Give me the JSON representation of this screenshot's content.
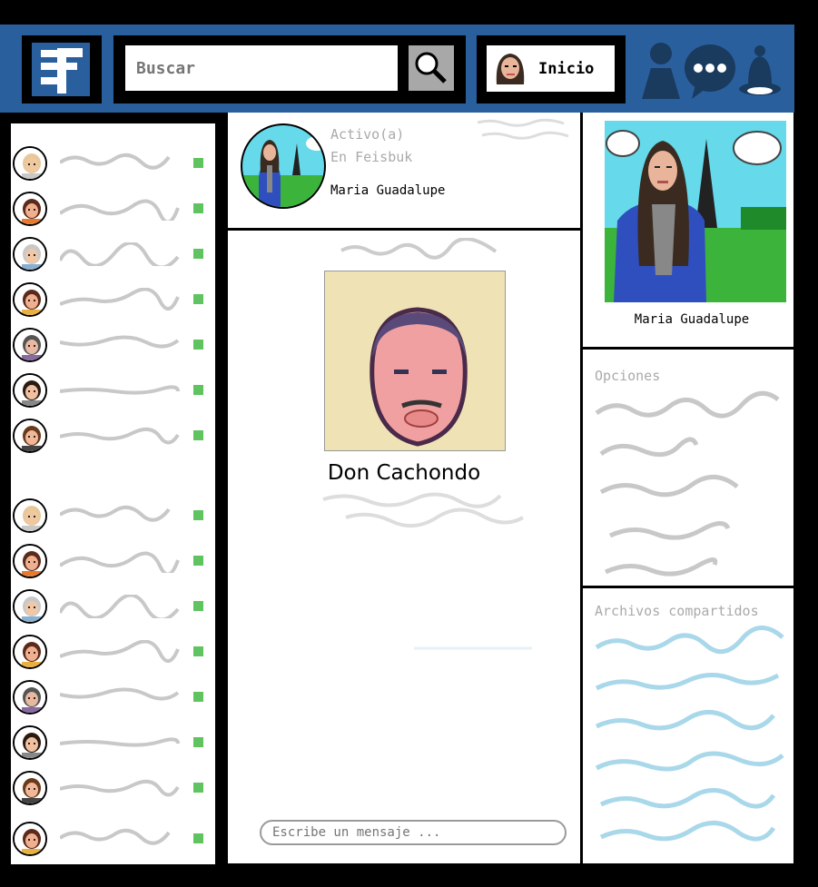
{
  "header": {
    "logo_icon": "feisbuk-logo-icon",
    "search": {
      "placeholder": "Buscar",
      "button_icon": "magnifier-icon"
    },
    "home": {
      "label": "Inicio",
      "avatar_icon": "user-avatar-icon"
    },
    "icons": [
      "friends-icon",
      "messages-icon",
      "notifications-bell-icon"
    ]
  },
  "friends": {
    "items": [
      {
        "avatar": "blond-man-icon",
        "online": true
      },
      {
        "avatar": "girl-pigtails-icon",
        "online": true
      },
      {
        "avatar": "grandma-icon",
        "online": true
      },
      {
        "avatar": "curly-girl-icon",
        "online": true
      },
      {
        "avatar": "gray-haired-woman-icon",
        "online": true
      },
      {
        "avatar": "dark-haired-woman-icon",
        "online": true
      },
      {
        "avatar": "brown-haired-man-icon",
        "online": true
      },
      {
        "avatar": "blond-man-icon",
        "online": true
      },
      {
        "avatar": "girl-pigtails-icon",
        "online": true
      },
      {
        "avatar": "grandma-icon",
        "online": true
      },
      {
        "avatar": "curly-girl-icon",
        "online": true
      },
      {
        "avatar": "gray-haired-woman-icon",
        "online": true
      },
      {
        "avatar": "dark-haired-woman-icon",
        "online": true
      },
      {
        "avatar": "brown-haired-man-icon",
        "online": true
      },
      {
        "avatar": "curly-girl-icon",
        "online": true
      }
    ]
  },
  "chat_header": {
    "status_line1": "Activo(a)",
    "status_line2": "En Feisbuk",
    "name": "Maria Guadalupe"
  },
  "chat": {
    "contact_name": "Don Cachondo",
    "message_placeholder": "Escribe un mensaje ..."
  },
  "profile": {
    "name": "Maria Guadalupe"
  },
  "options": {
    "title": "Opciones"
  },
  "shared_files": {
    "title": "Archivos compartidos"
  },
  "colors": {
    "brand_blue": "#2a5f9e",
    "online_green": "#5fc45f",
    "scribble_gray": "#c8c8c8",
    "scribble_blue": "#a9d8ea"
  }
}
